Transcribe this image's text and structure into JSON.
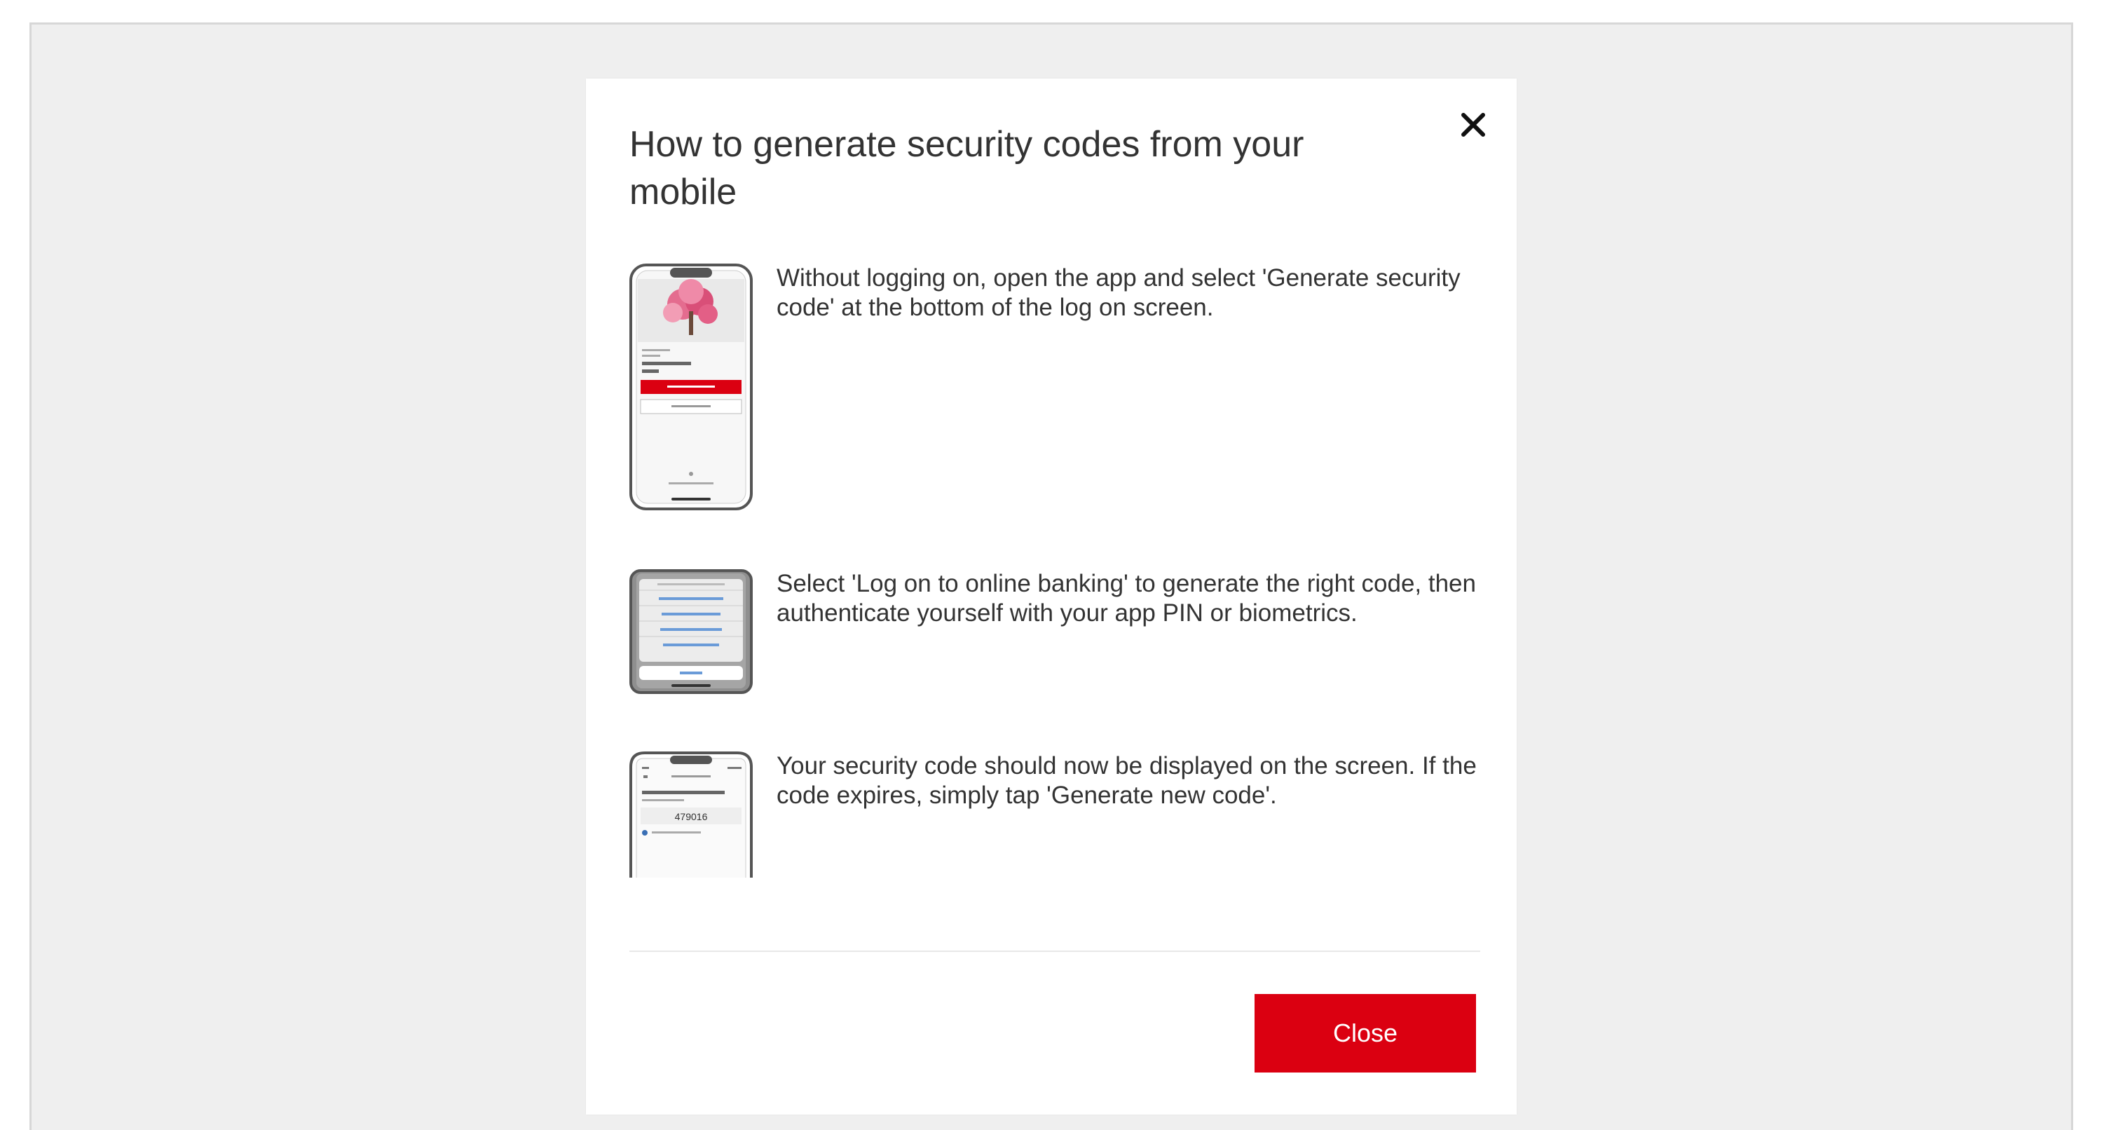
{
  "modal": {
    "title": "How to generate security codes from your mobile",
    "close_icon": "close-icon",
    "close_button_label": "Close"
  },
  "steps": [
    {
      "text": "Without logging on, open the app and select 'Generate security code' at the bottom of the log on screen.",
      "image_icon": "phone-login-screen-icon"
    },
    {
      "text": "Select 'Log on to online banking' to generate the right code, then authenticate yourself with your app PIN or biometrics.",
      "image_icon": "phone-menu-screen-icon"
    },
    {
      "text": "Your security code should now be displayed on the screen. If the code expires, simply tap 'Generate new code'.",
      "image_icon": "phone-code-screen-icon",
      "sample_code": "479016"
    }
  ],
  "colors": {
    "brand_red": "#db0011",
    "backdrop": "#efefef",
    "text": "#333333"
  }
}
